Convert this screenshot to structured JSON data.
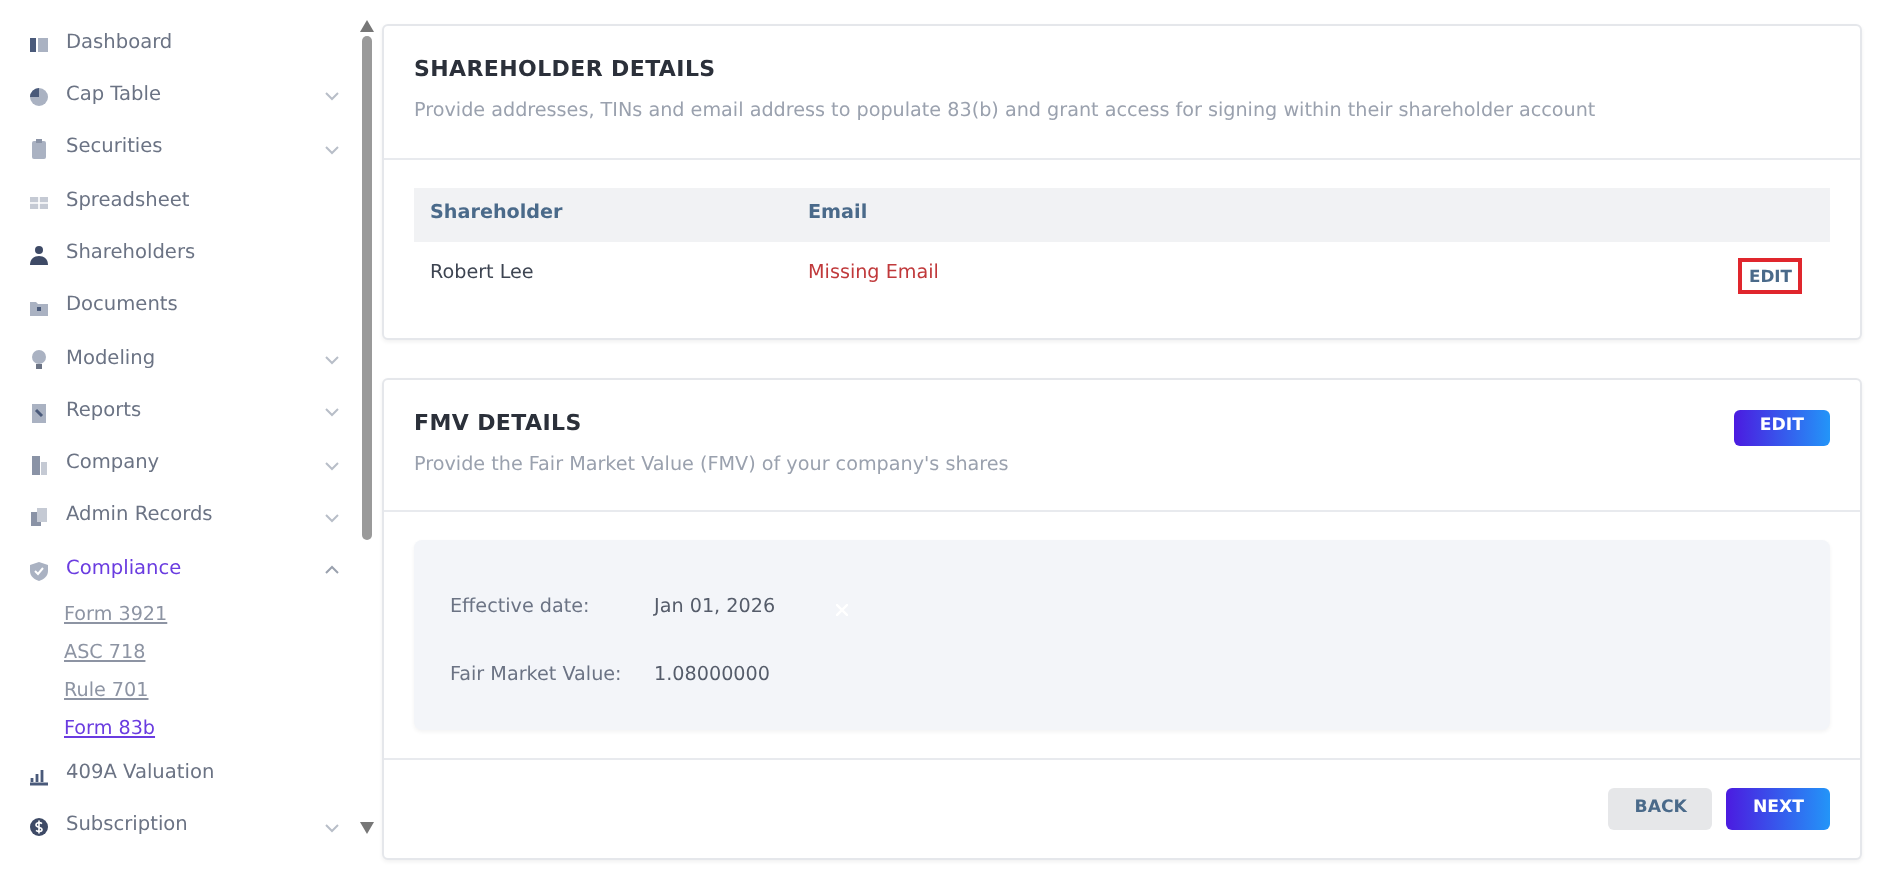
{
  "sidebar": {
    "items": [
      {
        "label": "Dashboard",
        "selected": false
      },
      {
        "label": "Cap Table",
        "expanded": false,
        "selected": false
      },
      {
        "label": "Securities",
        "expanded": false,
        "selected": false
      },
      {
        "label": "Spreadsheet",
        "selected": false
      },
      {
        "label": "Shareholders",
        "selected": false
      },
      {
        "label": "Documents",
        "selected": false
      },
      {
        "label": "Modeling",
        "expanded": false,
        "selected": false
      },
      {
        "label": "Reports",
        "expanded": false,
        "selected": false
      },
      {
        "label": "Company",
        "expanded": false,
        "selected": false
      },
      {
        "label": "Admin Records",
        "expanded": false,
        "selected": false
      },
      {
        "label": "Compliance",
        "expanded": true,
        "selected": true,
        "children": [
          {
            "label": "Form 3921",
            "selected": false
          },
          {
            "label": "ASC 718",
            "selected": false
          },
          {
            "label": "Rule 701",
            "selected": false
          },
          {
            "label": "Form 83b",
            "selected": true
          }
        ]
      },
      {
        "label": "409A Valuation",
        "selected": false
      },
      {
        "label": "Subscription",
        "expanded": false,
        "selected": false
      }
    ]
  },
  "shareholder_details": {
    "title": "SHAREHOLDER DETAILS",
    "description": "Provide addresses, TINs and email address to populate 83(b) and grant access for signing within their shareholder account",
    "table": {
      "columns": [
        "Shareholder",
        "Email"
      ],
      "rows": [
        {
          "shareholder": "Robert Lee",
          "email": "Missing Email",
          "email_missing": true,
          "action": "EDIT"
        }
      ]
    }
  },
  "fmv_details": {
    "title": "FMV DETAILS",
    "description": "Provide the Fair Market Value (FMV) of your company's shares",
    "edit_button": "EDIT",
    "fields": [
      {
        "label": "Effective date:",
        "value": "Jan 01, 2026",
        "clearable": true
      },
      {
        "label": "Fair Market Value:",
        "value": "1.08000000"
      }
    ]
  },
  "footer_buttons": [
    {
      "label": "BACK",
      "kind": "secondary"
    },
    {
      "label": "NEXT",
      "kind": "primary"
    }
  ]
}
